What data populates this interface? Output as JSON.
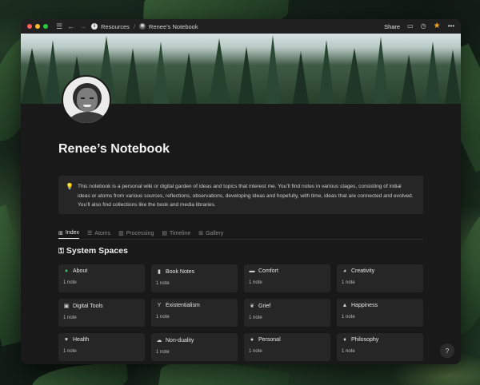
{
  "titlebar": {
    "breadcrumb": [
      {
        "label": "Resources",
        "icon": "info-circle-icon"
      },
      {
        "label": "Renee’s Notebook",
        "icon": "avatar-icon"
      }
    ],
    "share_label": "Share",
    "icons": [
      "menu-icon",
      "back-arrow-icon",
      "forward-arrow-icon",
      "comment-icon",
      "history-icon",
      "star-icon",
      "more-icon"
    ]
  },
  "page": {
    "title": "Renee’s Notebook",
    "callout": "This notebook is a personal wiki or digital garden of ideas and topics that interest me. You’ll find notes in various stages, consisting of initial ideas or atoms from various sources, reflections, observations, developing ideas and hopefully, with time, ideas that are connected and evolved. You’ll also find collections like the book and media libraries."
  },
  "tabs": [
    {
      "label": "Index",
      "active": true
    },
    {
      "label": "Atoms"
    },
    {
      "label": "Processing"
    },
    {
      "label": "Timeline"
    },
    {
      "label": "Gallery"
    }
  ],
  "section": {
    "title": "System Spaces"
  },
  "cards": [
    {
      "label": "About",
      "count": "1 note",
      "icon": "person-icon",
      "color": "#3fbf6a"
    },
    {
      "label": "Book Notes",
      "count": "1 note",
      "icon": "bookmark-icon"
    },
    {
      "label": "Comfort",
      "count": "1 note",
      "icon": "sofa-icon"
    },
    {
      "label": "Creativity",
      "count": "1 note",
      "icon": "palette-icon"
    },
    {
      "label": "Digital Tools",
      "count": "1 note",
      "icon": "window-icon"
    },
    {
      "label": "Existentialism",
      "count": "1 note",
      "icon": "goblet-icon"
    },
    {
      "label": "Grief",
      "count": "1 note",
      "icon": "leaf-icon"
    },
    {
      "label": "Happiness",
      "count": "1 note",
      "icon": "mountain-icon"
    },
    {
      "label": "Health",
      "count": "1 note",
      "icon": "heart-icon"
    },
    {
      "label": "Non-duality",
      "count": "1 note",
      "icon": "cloud-icon"
    },
    {
      "label": "Personal",
      "count": "1 note",
      "icon": "chat-icon"
    },
    {
      "label": "Philosophy",
      "count": "1 note",
      "icon": "lightbulb-icon"
    }
  ],
  "help_label": "?"
}
